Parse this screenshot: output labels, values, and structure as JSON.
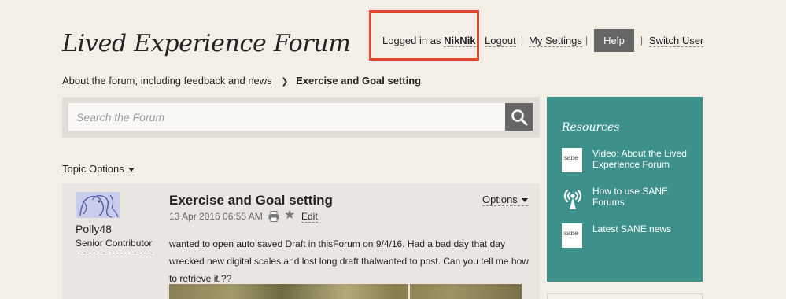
{
  "header": {
    "site_title": "Lived Experience Forum",
    "logged_in_prefix": "Logged in as",
    "username": "NikNik",
    "logout": "Logout",
    "my_settings": "My Settings",
    "help": "Help",
    "switch_user": "Switch User",
    "separator": "|"
  },
  "breadcrumb": {
    "parent": "About the forum, including feedback and news",
    "current": "Exercise and Goal setting"
  },
  "search": {
    "placeholder": "Search the Forum"
  },
  "topic_options": "Topic Options",
  "post": {
    "author": "Polly48",
    "rank": "Senior Contributor",
    "title": "Exercise and Goal setting",
    "date": "13 Apr 2016 06:55 AM",
    "edit": "Edit",
    "options": "Options",
    "body": "wanted to open auto saved Draft in thisForum on 9/4/16. Had a bad day that day wrecked new digital scales and lost long draft thalwanted to post.  Can you tell me how  to retrieve it.??"
  },
  "sidebar": {
    "title": "Resources",
    "items": [
      {
        "label": "Video: About the Lived Experience Forum",
        "icon": "sane-document-icon",
        "icon_text": "sane"
      },
      {
        "label": "How to use SANE Forums",
        "icon": "broadcast-icon"
      },
      {
        "label": "Latest SANE news",
        "icon": "sane-document-icon",
        "icon_text": "sane"
      }
    ]
  },
  "colors": {
    "background": "#f3efe7",
    "highlight": "#e0472f",
    "sidebar": "#3e918a",
    "button": "#666666"
  }
}
